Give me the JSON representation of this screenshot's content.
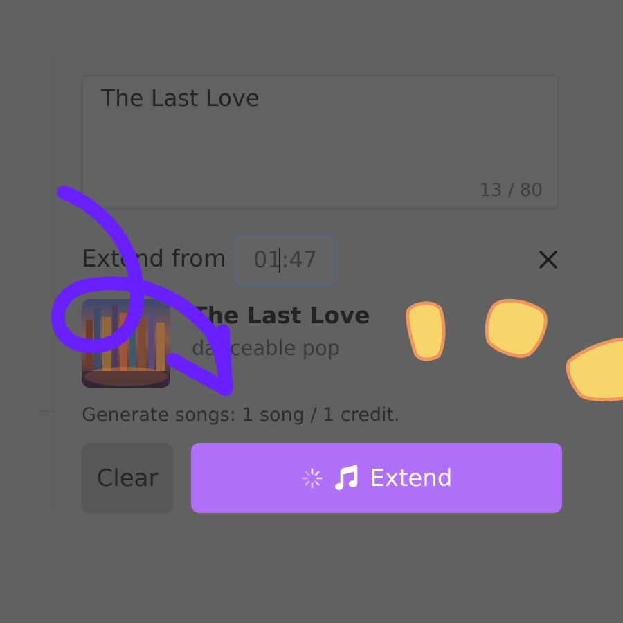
{
  "form": {
    "title_value": "The Last Love",
    "char_count": "13 / 80",
    "extend_label": "Extend from",
    "extend_time": "01:47",
    "credits_note": "Generate songs: 1 song / 1 credit."
  },
  "song": {
    "title": "The Last Love",
    "genre": "danceable pop"
  },
  "actions": {
    "clear_label": "Clear",
    "extend_label": "Extend"
  },
  "icons": {
    "close": "close-icon",
    "spinner": "loading-spinner-icon",
    "music": "music-note-icon"
  },
  "colors": {
    "background_dim": "#616161",
    "extend_button": "#b16ffa",
    "annotation_arrow": "#6a1fff",
    "annotation_marks_fill": "#f8d56a",
    "annotation_marks_stroke": "#f0965a"
  }
}
